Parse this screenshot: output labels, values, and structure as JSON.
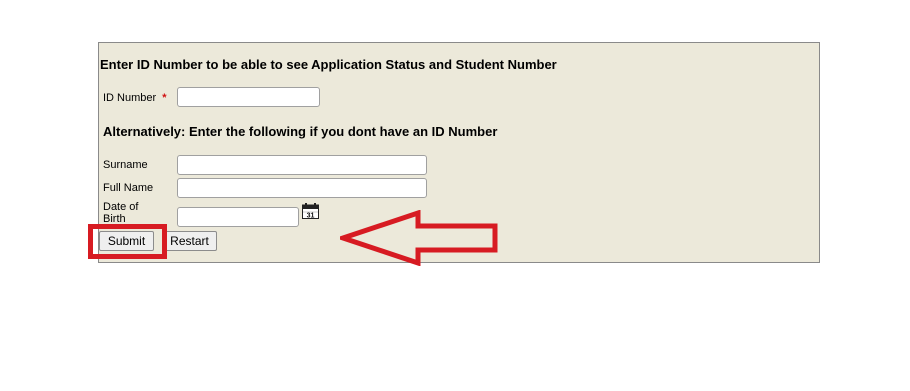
{
  "form": {
    "heading": "Enter ID Number to be able to see Application Status and Student Number",
    "id_number_label": "ID Number",
    "required_marker": "*",
    "id_number_value": "",
    "alt_heading": "Alternatively: Enter the following if you dont have an ID Number",
    "surname_label": "Surname",
    "surname_value": "",
    "full_name_label": "Full Name",
    "full_name_value": "",
    "dob_label": "Date of Birth",
    "dob_value": "",
    "calendar_day": "31"
  },
  "buttons": {
    "submit_label": "Submit",
    "restart_label": "Restart"
  },
  "annotation": {
    "highlight_color": "#d71b22",
    "arrow_color": "#d71b22"
  },
  "colors": {
    "panel_background": "#ece9da"
  }
}
